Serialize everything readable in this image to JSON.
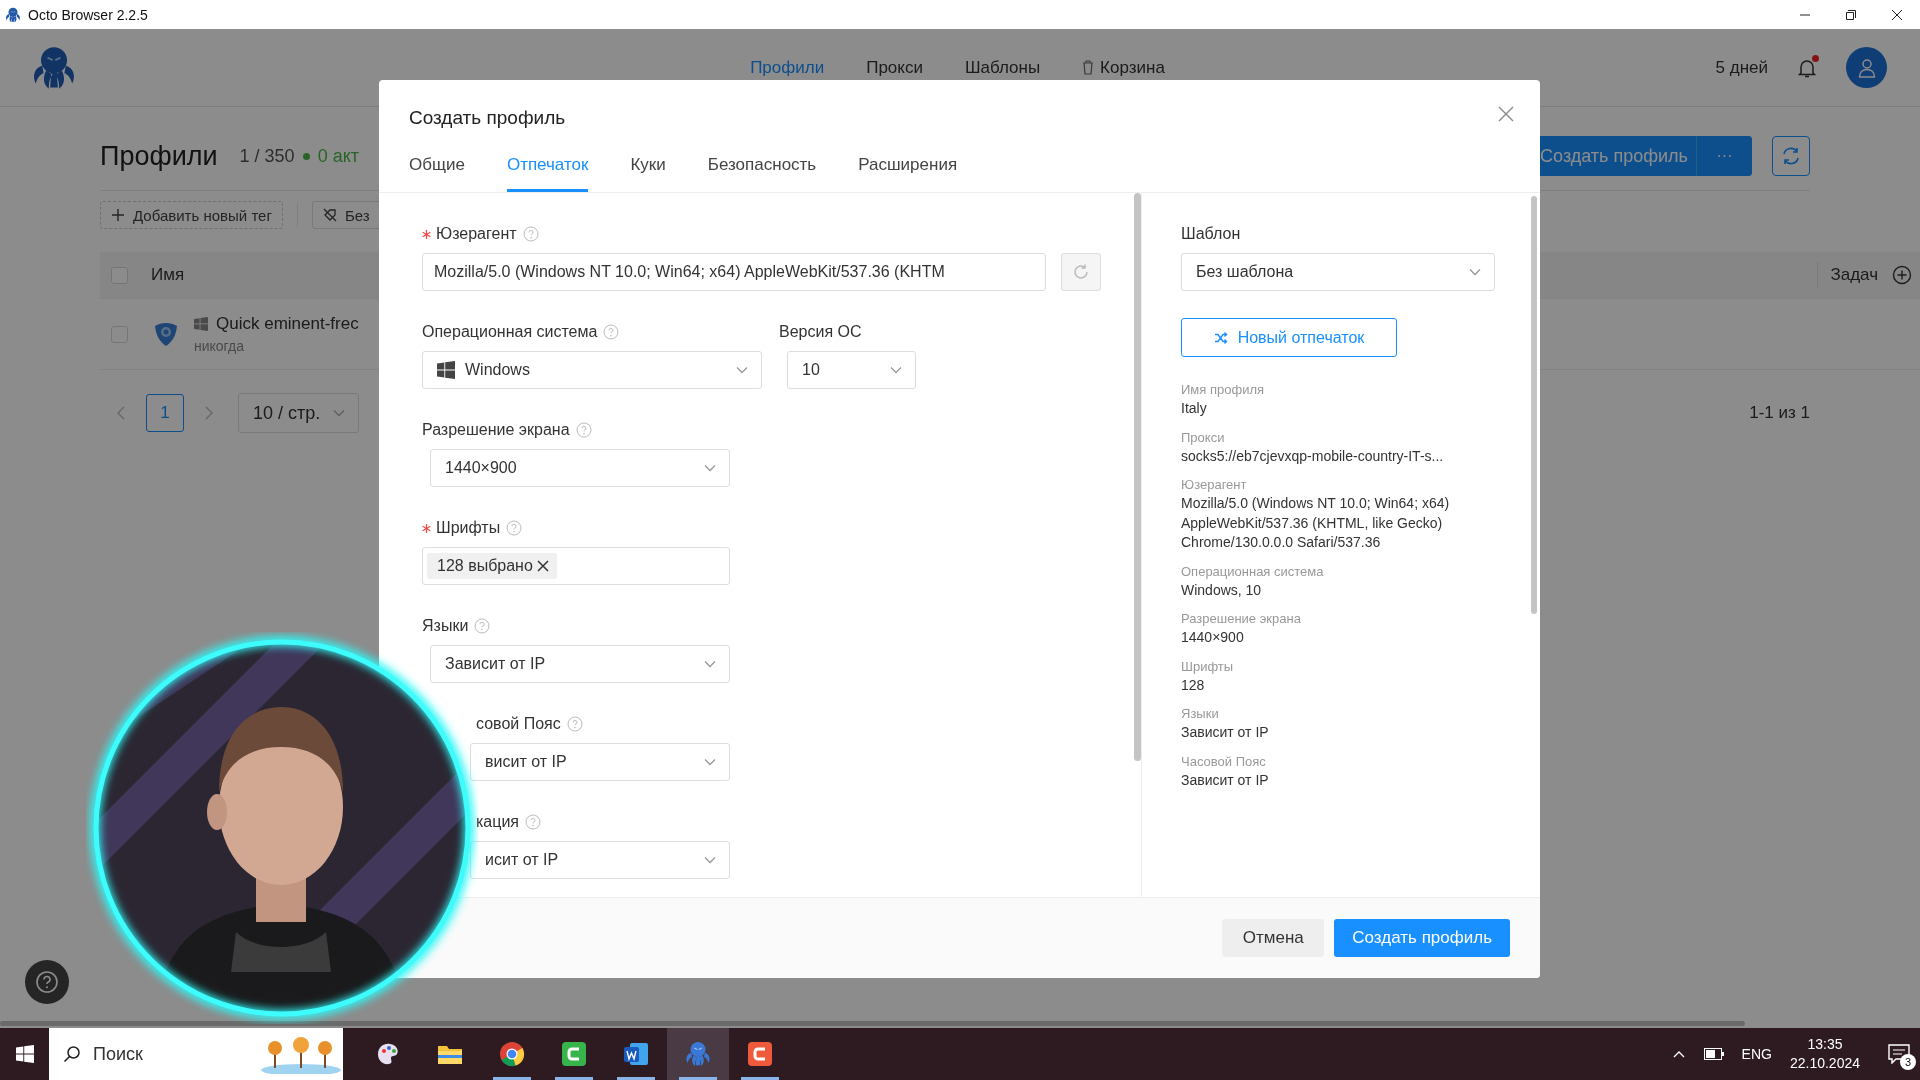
{
  "window": {
    "title": "Octo Browser 2.2.5"
  },
  "nav": [
    {
      "label": "Профили",
      "selected": true,
      "kind": "link"
    },
    {
      "label": "Прокси",
      "selected": false,
      "kind": "link"
    },
    {
      "label": "Шаблоны",
      "selected": false,
      "kind": "link"
    },
    {
      "label": "Корзина",
      "selected": false,
      "kind": "trash"
    }
  ],
  "account": {
    "subscription": "5 дней",
    "unread": true
  },
  "profiles": {
    "title": "Профили",
    "count": "1 / 350",
    "active": "0 акт",
    "add_tag": "Добавить новый тег",
    "tag_filter": "Без",
    "create": "Создать профиль",
    "more": "···"
  },
  "table": {
    "all_checked": false,
    "columns": [
      "Имя",
      "Задач"
    ],
    "rows": [
      {
        "checked": false,
        "name": "Quick eminent-frec",
        "last_launch": "никогда"
      }
    ]
  },
  "pagination": {
    "pages": [
      {
        "label": "1",
        "selected": true
      }
    ],
    "page_size": "10 / стр.",
    "range": "1-1 из 1"
  },
  "dialog": {
    "title": "Создать профиль",
    "tabs": [
      {
        "label": "Общие",
        "selected": false
      },
      {
        "label": "Отпечаток",
        "selected": true
      },
      {
        "label": "Куки",
        "selected": false
      },
      {
        "label": "Безопасность",
        "selected": false
      },
      {
        "label": "Расширения",
        "selected": false
      }
    ],
    "rows": [
      {
        "fields": [
          {
            "label": "Юзерагент",
            "required": true,
            "help": true,
            "kind": "text",
            "value": "Mozilla/5.0 (Windows NT 10.0; Win64; x64) AppleWebKit/537.36 (KHTM",
            "covered": false
          }
        ]
      },
      {
        "fields": [
          {
            "label": "Операционная система",
            "required": false,
            "help": true,
            "kind": "os-select",
            "value": "Windows",
            "covered": false
          },
          {
            "label": "Версия ОС",
            "required": false,
            "help": false,
            "kind": "select",
            "value": "10",
            "covered": false
          }
        ]
      },
      {
        "fields": [
          {
            "label": "Разрешение экрана",
            "required": false,
            "help": true,
            "kind": "select",
            "value": "1440×900",
            "covered": false
          }
        ]
      },
      {
        "fields": [
          {
            "label": "Шрифты",
            "required": true,
            "help": true,
            "kind": "tags",
            "tags": [
              "128 выбрано"
            ],
            "covered": false
          }
        ]
      },
      {
        "fields": [
          {
            "label": "Языки",
            "required": false,
            "help": true,
            "kind": "select",
            "value": "Зависит от IP",
            "covered": false
          }
        ]
      },
      {
        "fields": [
          {
            "label": "совой Пояс",
            "required": false,
            "help": true,
            "kind": "select",
            "value": "висит от IP",
            "covered": true
          }
        ]
      },
      {
        "fields": [
          {
            "label": "кация",
            "required": false,
            "help": true,
            "kind": "select",
            "value": "исит от IP",
            "covered": true
          }
        ]
      }
    ],
    "template": {
      "label": "Шаблон",
      "value": "Без шаблона"
    },
    "new_fingerprint": "Новый отпечаток",
    "summary": [
      {
        "label": "Имя профиля",
        "value": "Italy"
      },
      {
        "label": "Прокси",
        "value": "socks5://eb7cjevxqp-mobile-country-IT-s..."
      },
      {
        "label": "Юзерагент",
        "value": "Mozilla/5.0 (Windows NT 10.0; Win64; x64) AppleWebKit/537.36 (KHTML, like Gecko) Chrome/130.0.0.0 Safari/537.36"
      },
      {
        "label": "Операционная система",
        "value": "Windows, 10"
      },
      {
        "label": "Разрешение экрана",
        "value": "1440×900"
      },
      {
        "label": "Шрифты",
        "value": "128"
      },
      {
        "label": "Языки",
        "value": "Зависит от IP"
      },
      {
        "label": "Часовой Пояс",
        "value": "Зависит от IP"
      }
    ],
    "cancel": "Отмена",
    "submit": "Создать профиль"
  },
  "taskbar": {
    "search_placeholder": "Поиск",
    "apps": [
      {
        "kind": "palette",
        "running": false,
        "selected": false
      },
      {
        "kind": "folder",
        "running": false,
        "selected": false
      },
      {
        "kind": "browser",
        "running": true,
        "selected": false
      },
      {
        "kind": "green-app",
        "running": true,
        "selected": false
      },
      {
        "kind": "document",
        "running": true,
        "selected": false
      },
      {
        "kind": "octopus",
        "running": true,
        "selected": true
      },
      {
        "kind": "red-app",
        "running": true,
        "selected": false
      }
    ],
    "language": "ENG",
    "time": "13:35",
    "date": "22.10.2024",
    "notifications": "3"
  }
}
